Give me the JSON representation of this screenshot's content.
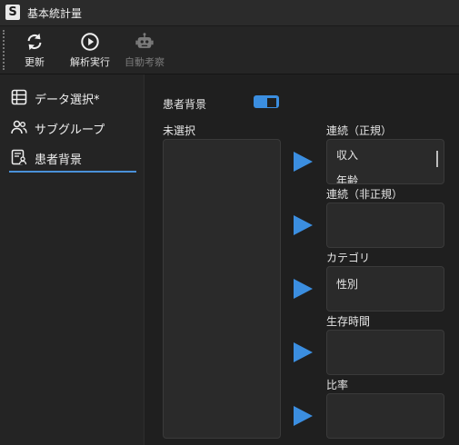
{
  "window": {
    "app_letter": "S",
    "title": "基本統計量"
  },
  "toolbar": {
    "refresh_label": "更新",
    "run_label": "解析実行",
    "auto_label": "自動考察"
  },
  "sidebar": {
    "items": [
      {
        "label": "データ選択*",
        "icon": "table-icon"
      },
      {
        "label": "サブグループ",
        "icon": "people-icon"
      },
      {
        "label": "患者背景",
        "icon": "document-person-icon"
      }
    ],
    "active_index": 2
  },
  "main": {
    "toggle_label": "患者背景",
    "toggle_on": true,
    "unselected_label": "未選択",
    "unselected_items": [],
    "groups": [
      {
        "label": "連続（正規）",
        "items": [
          "収入",
          "年齢"
        ]
      },
      {
        "label": "連続（非正規）",
        "items": []
      },
      {
        "label": "カテゴリ",
        "items": [
          "性別"
        ]
      },
      {
        "label": "生存時間",
        "items": []
      },
      {
        "label": "比率",
        "items": []
      }
    ]
  },
  "colors": {
    "accent": "#3b8ee0",
    "background": "#1f1f1f",
    "panel": "#2a2a2a"
  }
}
